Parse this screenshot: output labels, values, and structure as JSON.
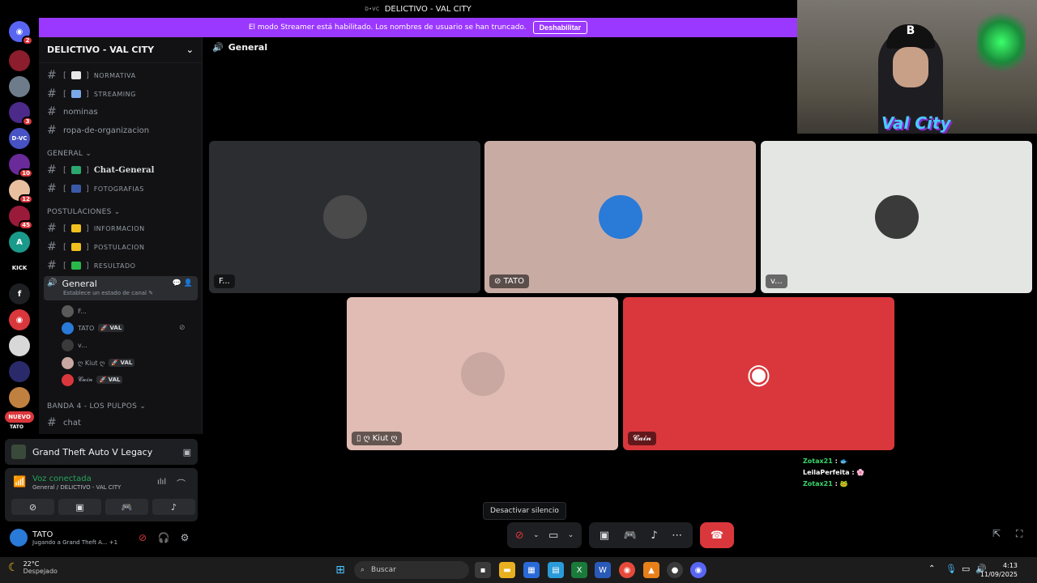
{
  "window": {
    "title": "DELICTIVO - VAL CITY",
    "logo_text": "D•VC"
  },
  "banner": {
    "text": "El modo Streamer está habilitado. Los nombres de usuario se han truncado.",
    "button": "Deshabilitar"
  },
  "rail": {
    "servers": [
      {
        "name": "discord-home",
        "glyph": "◉",
        "color": "#5865f2",
        "badge": "2"
      },
      {
        "name": "server-red-gun",
        "glyph": "",
        "color": "#8b1d2c",
        "badge": ""
      },
      {
        "name": "server-city",
        "glyph": "",
        "color": "#6d7b8a",
        "badge": ""
      },
      {
        "name": "server-purple",
        "glyph": "",
        "color": "#4b2a8a",
        "badge": "3"
      },
      {
        "name": "server-dvc",
        "glyph": "D-VC",
        "color": "#4752c4",
        "badge": ""
      },
      {
        "name": "server-neon",
        "glyph": "",
        "color": "#6a2a9a",
        "badge": "10"
      },
      {
        "name": "server-orange",
        "glyph": "",
        "color": "#e8c0a0",
        "badge": "12"
      },
      {
        "name": "server-crimson",
        "glyph": "",
        "color": "#9a1a3a",
        "badge": "45"
      },
      {
        "name": "server-a",
        "glyph": "A",
        "color": "#1a9a8a",
        "badge": ""
      },
      {
        "name": "server-kick",
        "glyph": "KICK",
        "color": "#000000",
        "badge": ""
      },
      {
        "name": "server-f",
        "glyph": "f",
        "color": "#1e1f22",
        "badge": ""
      },
      {
        "name": "server-discord-red",
        "glyph": "◉",
        "color": "#da373c",
        "badge": ""
      },
      {
        "name": "server-logo-white",
        "glyph": "",
        "color": "#d8d8d8",
        "badge": ""
      },
      {
        "name": "server-blue-logo",
        "glyph": "",
        "color": "#2a2a6a",
        "badge": ""
      },
      {
        "name": "server-gta",
        "glyph": "",
        "color": "#c08040",
        "badge": ""
      }
    ],
    "nuevo_label": "NUEVO",
    "tato_label": "TATO"
  },
  "sidebar": {
    "server_name": "DELICTIVO - VAL CITY",
    "channels_top": [
      {
        "label": "NORMATIVA",
        "emoji": "#e8e8e8",
        "style": "smallcaps"
      },
      {
        "label": "STREAMING",
        "emoji": "#7aa8e8",
        "style": "smallcaps"
      },
      {
        "label": "nominas",
        "emoji": "",
        "style": "plain"
      },
      {
        "label": "ropa-de-organizacion",
        "emoji": "",
        "style": "plain"
      }
    ],
    "category_general": "GENERAL",
    "channels_general": [
      {
        "label": "Chat-General",
        "emoji": "#2aa870",
        "style": "serif"
      },
      {
        "label": "FOTOGRAFIAS",
        "emoji": "#3a5aa8",
        "style": "smallcaps"
      }
    ],
    "category_postulaciones": "POSTULACIONES",
    "channels_postulaciones": [
      {
        "label": "INFORMACION",
        "emoji": "#f0c020",
        "style": "smallcaps"
      },
      {
        "label": "POSTULACION",
        "emoji": "#f0c020",
        "style": "smallcaps"
      },
      {
        "label": "RESULTADO",
        "emoji": "#2ab84a",
        "style": "smallcaps"
      }
    ],
    "voice_channel": {
      "label": "General",
      "sub": "Establece un estado de canal ✎"
    },
    "voice_users": [
      {
        "name": "F...",
        "color": "#5a5a5a",
        "tag": ""
      },
      {
        "name": "TATO",
        "color": "#2a7ad8",
        "tag": "🚀 VAL",
        "muted": true
      },
      {
        "name": "v...",
        "color": "#3a3a3a",
        "tag": ""
      },
      {
        "name": "ღ Kiut ღ",
        "color": "#c8a8a0",
        "tag": "🚀 VAL"
      },
      {
        "name": "𝓒𝓪𝓲𝓷",
        "color": "#da373c",
        "tag": "🚀 VAL"
      }
    ],
    "category_banda": "BANDA 4 - LOS PULPOS",
    "channel_chat": "chat"
  },
  "activity": {
    "game": "Grand Theft Auto V Legacy"
  },
  "voice_status": {
    "state": "Voz conectada",
    "location": "General / DELICTIVO - VAL CITY"
  },
  "user": {
    "name": "TATO",
    "status": "Jugando a Grand Theft A...",
    "extra": "+1"
  },
  "stage": {
    "channel_name": "General",
    "tiles": [
      {
        "name": "F...",
        "bg": "#2b2d31",
        "avatar": "#4a4a4a"
      },
      {
        "name": "TATO",
        "bg": "#c8aca4",
        "avatar": "#2a7ad8",
        "muted": true
      },
      {
        "name": "v...",
        "bg": "#e4e6e4",
        "avatar": "#3a3a3a"
      },
      {
        "name": "ღ Kiut ღ",
        "bg": "#e0bcb4",
        "avatar": "#c8a8a0",
        "mobile": true
      },
      {
        "name": "𝓒𝓪𝓲𝓷",
        "bg": "#da373c",
        "avatar": "discord"
      }
    ]
  },
  "chat_overlay": [
    {
      "user": "Zotax21",
      "text": ":",
      "emoji": "🐟",
      "color": "#3ad86a"
    },
    {
      "user": "LeilaPerfeita",
      "text": ":",
      "emoji": "🌸",
      "color": "#ffffff"
    },
    {
      "user": "Zotax21",
      "text": ":",
      "emoji": "🐸",
      "color": "#3ad86a"
    }
  ],
  "controls": {
    "tooltip": "Desactivar silencio"
  },
  "webcam": {
    "overlay_text": "Val City"
  },
  "taskbar": {
    "weather_temp": "22°C",
    "weather_desc": "Despejado",
    "search_placeholder": "Buscar",
    "time": "4:13",
    "date": "11/09/2025"
  }
}
